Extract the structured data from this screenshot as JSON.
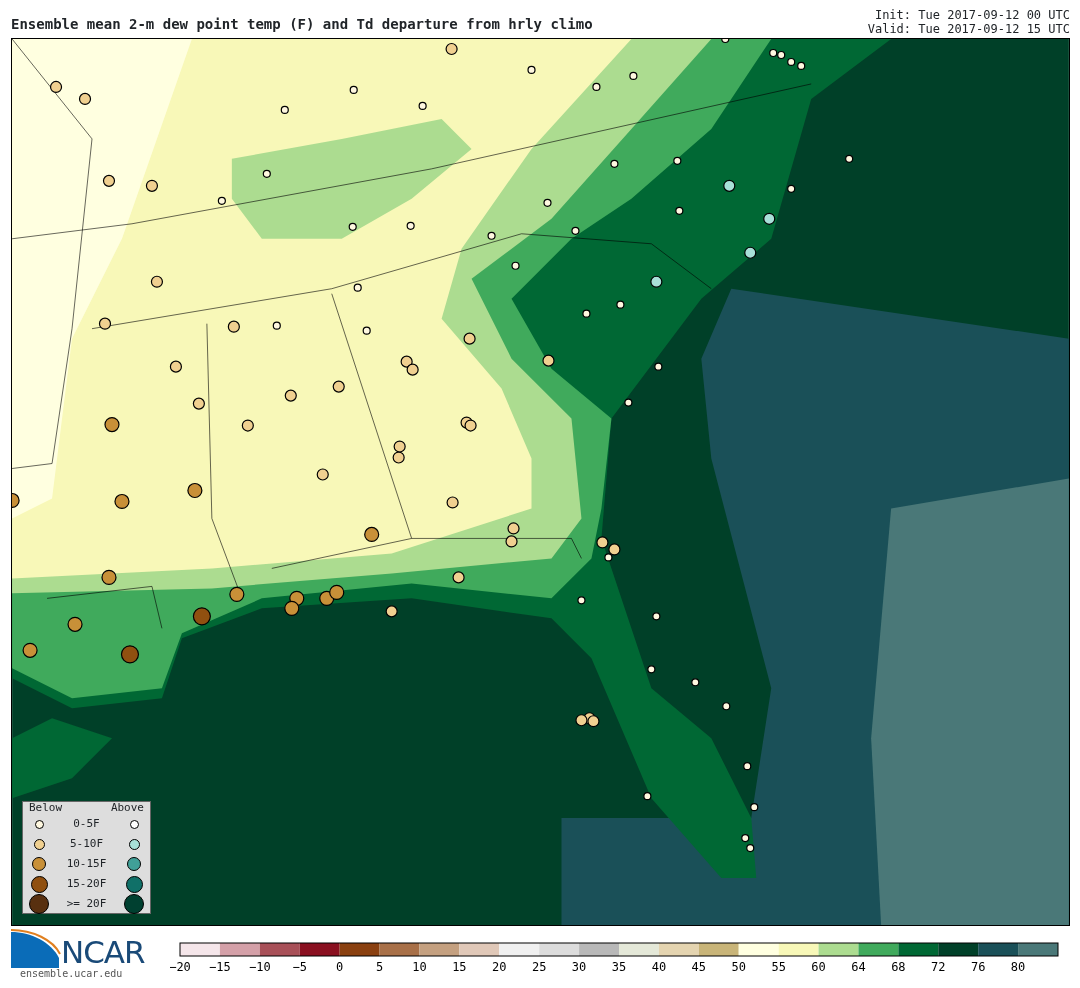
{
  "title": "Ensemble mean 2-m dew point temp (F) and Td departure from hrly climo",
  "init": "Init: Tue 2017-09-12 00 UTC",
  "valid": "Valid: Tue 2017-09-12 15 UTC",
  "legend": {
    "below_header": "Below",
    "above_header": "Above",
    "rows": [
      {
        "label": "0-5F",
        "below": {
          "color": "#fff8e0"
        },
        "above": {
          "color": "#ffffff"
        }
      },
      {
        "label": "5-10F",
        "below": {
          "color": "#f0d090"
        },
        "above": {
          "color": "#a8e0d8"
        }
      },
      {
        "label": "10-15F",
        "below": {
          "color": "#c89038"
        },
        "above": {
          "color": "#40a098"
        }
      },
      {
        "label": "15-20F",
        "below": {
          "color": "#905010"
        },
        "above": {
          "color": "#107068"
        }
      },
      {
        "label": ">= 20F",
        "below": {
          "color": "#583010"
        },
        "above": {
          "color": "#004030"
        }
      }
    ]
  },
  "colorbar": {
    "segments": [
      {
        "color": "#f5e6ea"
      },
      {
        "color": "#d4a0a8"
      },
      {
        "color": "#a85058"
      },
      {
        "color": "#8a1020"
      },
      {
        "color": "#8a4010"
      },
      {
        "color": "#a87048"
      },
      {
        "color": "#c4a080"
      },
      {
        "color": "#e0c8b8"
      },
      {
        "color": "#f0f0f0"
      },
      {
        "color": "#dcdcdc"
      },
      {
        "color": "#b8b8b8"
      },
      {
        "color": "#e4e8d8"
      },
      {
        "color": "#e4d4b0"
      },
      {
        "color": "#c8b478"
      },
      {
        "color": "#ffffe0"
      },
      {
        "color": "#f8f8b8"
      },
      {
        "color": "#acdc90"
      },
      {
        "color": "#40aa5c"
      },
      {
        "color": "#006834"
      },
      {
        "color": "#004028"
      },
      {
        "color": "#1a5058"
      },
      {
        "color": "#4a7878"
      }
    ],
    "ticks": [
      "−20",
      "−15",
      "−10",
      "−5",
      "0",
      "5",
      "10",
      "15",
      "20",
      "25",
      "30",
      "35",
      "40",
      "45",
      "50",
      "55",
      "60",
      "64",
      "68",
      "72",
      "76",
      "80"
    ]
  },
  "logo": {
    "text": "NCAR",
    "url": "ensemble.ucar.edu"
  }
}
